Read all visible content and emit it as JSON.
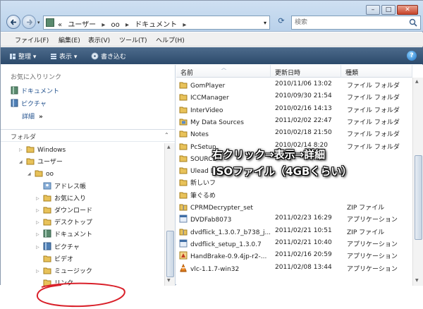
{
  "window": {
    "address_path": [
      "«",
      "ユーザー",
      "oo",
      "ドキュメント"
    ],
    "search_placeholder": "検索",
    "controls": {
      "minimize": "–",
      "maximize": "□",
      "close": "✕"
    }
  },
  "menubar": {
    "items": [
      "ファイル(F)",
      "編集(E)",
      "表示(V)",
      "ツール(T)",
      "ヘルプ(H)"
    ]
  },
  "toolbar": {
    "organize": "整理",
    "views": "表示",
    "burn": "書き込む",
    "help": "?"
  },
  "nav": {
    "favorites_header": "お気に入りリンク",
    "favorites": [
      "ドキュメント",
      "ピクチャ"
    ],
    "more": "詳細",
    "more_chevron": "»",
    "folders_header": "フォルダ",
    "tree": [
      {
        "label": "Windows",
        "depth": 1,
        "expander": "closed",
        "icon": "folder-icon"
      },
      {
        "label": "ユーザー",
        "depth": 1,
        "expander": "open",
        "icon": "folder-icon"
      },
      {
        "label": "oo",
        "depth": 2,
        "expander": "open",
        "icon": "folder-icon"
      },
      {
        "label": "アドレス帳",
        "depth": 3,
        "expander": "none",
        "icon": "contacts-icon"
      },
      {
        "label": "お気に入り",
        "depth": 3,
        "expander": "closed",
        "icon": "star-folder-icon"
      },
      {
        "label": "ダウンロード",
        "depth": 3,
        "expander": "closed",
        "icon": "download-folder-icon"
      },
      {
        "label": "デスクトップ",
        "depth": 3,
        "expander": "closed",
        "icon": "desktop-folder-icon"
      },
      {
        "label": "ドキュメント",
        "depth": 3,
        "expander": "closed",
        "icon": "documents-icon"
      },
      {
        "label": "ピクチャ",
        "depth": 3,
        "expander": "closed",
        "icon": "pictures-icon"
      },
      {
        "label": "ビデオ",
        "depth": 3,
        "expander": "none",
        "icon": "video-folder-icon"
      },
      {
        "label": "ミュージック",
        "depth": 3,
        "expander": "closed",
        "icon": "music-folder-icon"
      },
      {
        "label": "リンク",
        "depth": 3,
        "expander": "none",
        "icon": "links-folder-icon"
      }
    ]
  },
  "filelist": {
    "columns": [
      "名前",
      "更新日時",
      "種類"
    ],
    "rows": [
      {
        "name": "GomPlayer",
        "date": "2010/11/06 13:02",
        "type": "ファイル フォルダ",
        "icon": "folder-icon"
      },
      {
        "name": "ICCManager",
        "date": "2010/09/30 21:54",
        "type": "ファイル フォルダ",
        "icon": "folder-icon"
      },
      {
        "name": "InterVideo",
        "date": "2010/02/16 14:13",
        "type": "ファイル フォルダ",
        "icon": "folder-icon"
      },
      {
        "name": "My Data Sources",
        "date": "2011/02/02 22:47",
        "type": "ファイル フォルダ",
        "icon": "data-sources-folder-icon"
      },
      {
        "name": "Notes",
        "date": "2010/02/18 21:50",
        "type": "ファイル フォルダ",
        "icon": "folder-icon"
      },
      {
        "name": "PcSetup",
        "date": "2010/02/14 8:20",
        "type": "ファイル フォルダ",
        "icon": "folder-icon"
      },
      {
        "name": "SOURCE",
        "date": "",
        "type": "",
        "icon": "folder-icon"
      },
      {
        "name": "Ulead D",
        "date": "",
        "type": "",
        "icon": "folder-icon"
      },
      {
        "name": "新しいフ",
        "date": "",
        "type": "",
        "icon": "folder-icon"
      },
      {
        "name": "筆ぐるめ",
        "date": "",
        "type": "",
        "icon": "folder-icon"
      },
      {
        "name": "CPRMDecrypter_set",
        "date": "",
        "type": "ZIP ファイル",
        "icon": "zip-icon"
      },
      {
        "name": "DVDFab8073",
        "date": "2011/02/23 16:29",
        "type": "アプリケーション",
        "icon": "app-icon"
      },
      {
        "name": "dvdflick_1.3.0.7_b738_j...",
        "date": "2011/02/21 10:51",
        "type": "ZIP ファイル",
        "icon": "zip-icon"
      },
      {
        "name": "dvdflick_setup_1.3.0.7",
        "date": "2011/02/21 10:40",
        "type": "アプリケーション",
        "icon": "app-icon"
      },
      {
        "name": "HandBrake-0.9.4jp-r2-...",
        "date": "2011/02/16 20:59",
        "type": "アプリケーション",
        "icon": "handbrake-icon"
      },
      {
        "name": "vlc-1.1.7-win32",
        "date": "2011/02/08 13:44",
        "type": "アプリケーション",
        "icon": "vlc-cone-icon"
      }
    ]
  },
  "annotation": {
    "line1": "右クリック⇒表示⇒詳細",
    "line2": "ISOファイル（4GBくらい）",
    "circle_color": "#d9202a"
  },
  "colors": {
    "toolbar": "#3a5878",
    "accent_link": "#1f4f8c",
    "folder": "#e8c25a"
  }
}
